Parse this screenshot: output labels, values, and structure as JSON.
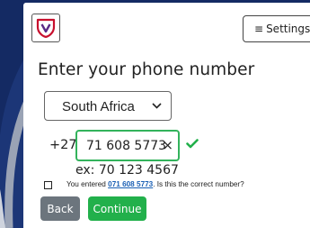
{
  "header": {
    "logo_icon": "shield-v-logo",
    "settings_label": "Settings",
    "settings_icon": "menu-icon"
  },
  "form": {
    "title": "Enter your phone number",
    "country": "South Africa",
    "prefix": "+27",
    "phone_value": "71 608 5773",
    "clear_glyph": "×",
    "example_hint": "ex: 70 123 4567",
    "confirm_prefix": "You entered ",
    "confirm_number": "071 608 5773",
    "confirm_suffix": ". Is this the correct number?",
    "confirm_checked": false
  },
  "actions": {
    "back_label": "Back",
    "continue_label": "Continue"
  },
  "colors": {
    "background": "#142a63",
    "accent_green": "#22b04b",
    "field_border_valid": "#33b35c",
    "back_button": "#6c757d",
    "link_blue": "#1a5fb4",
    "logo_red": "#c8102e",
    "logo_purple": "#5b2a86"
  }
}
